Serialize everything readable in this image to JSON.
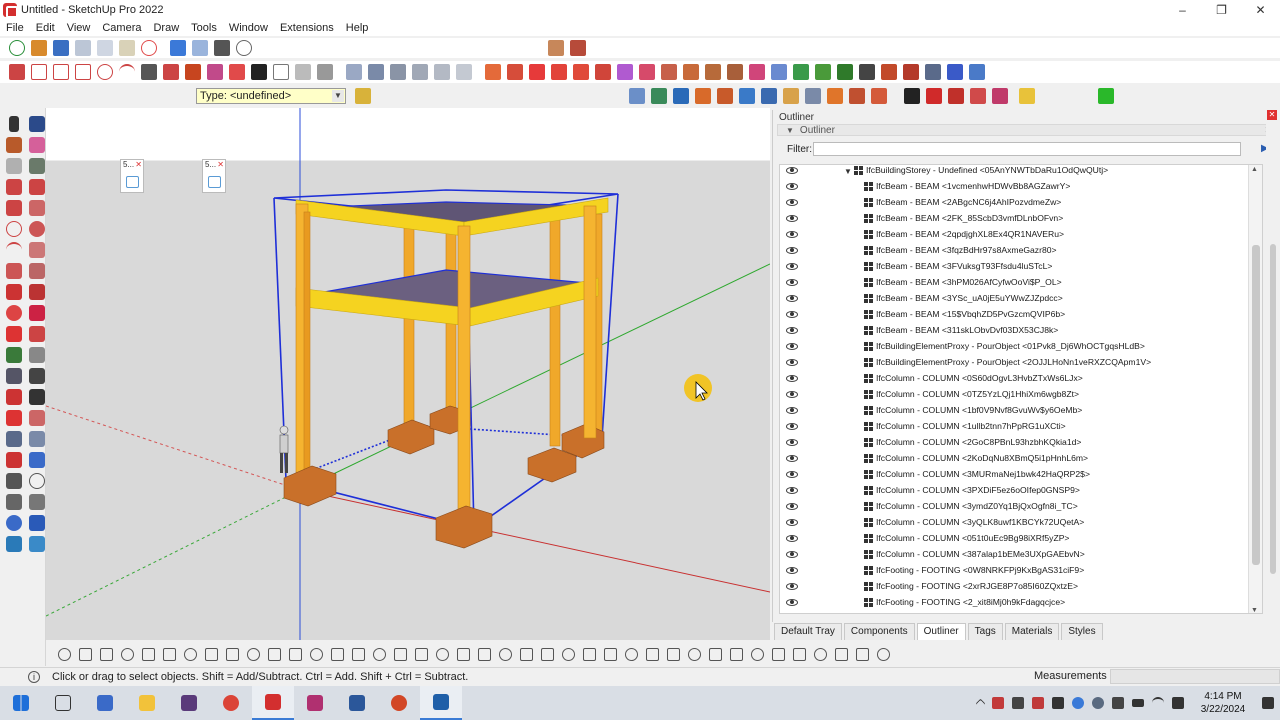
{
  "window": {
    "title": "Untitled - SketchUp Pro 2022",
    "controls": [
      "–",
      "❐",
      "✕"
    ]
  },
  "menu": [
    "File",
    "Edit",
    "View",
    "Camera",
    "Draw",
    "Tools",
    "Window",
    "Extensions",
    "Help"
  ],
  "type_box": {
    "value": "Type: <undefined>"
  },
  "scene_tags": [
    {
      "label": "5..."
    },
    {
      "label": "5..."
    }
  ],
  "outliner": {
    "panel_title": "Outliner",
    "section_title": "Outliner",
    "filter_label": "Filter:",
    "filter_value": "",
    "rows": [
      {
        "text": "IfcBuildingStorey - Undefined <05AnYNWTbDaRu1OdQwQUtj>",
        "level": 0,
        "expanded": true
      },
      {
        "text": "IfcBeam - BEAM <1vcmenhwHDWvBb8AGZawrY>",
        "level": 1
      },
      {
        "text": "IfcBeam - BEAM <2ABgcNC6j4AhIPozvdmeZw>",
        "level": 1
      },
      {
        "text": "IfcBeam - BEAM <2FK_85ScbD3vmfDLnbOFvn>",
        "level": 1
      },
      {
        "text": "IfcBeam - BEAM <2qpdjghXL8Ex4QR1NAVERu>",
        "level": 1
      },
      {
        "text": "IfcBeam - BEAM <3fqzBdHr97s8AxmeGazr80>",
        "level": 1
      },
      {
        "text": "IfcBeam - BEAM <3FVuksgT93Ffsdu4luSTcL>",
        "level": 1
      },
      {
        "text": "IfcBeam - BEAM <3hPM026AfCyfwOoVi$P_OL>",
        "level": 1
      },
      {
        "text": "IfcBeam - BEAM <3YSc_uA0jE5uYWwZJZpdcc>",
        "level": 1
      },
      {
        "text": "IfcBeam - BEAM <15$VbqhZD5PvGzcmQVIP6b>",
        "level": 1
      },
      {
        "text": "IfcBeam - BEAM <311skLObvDvf03DX53CJ8k>",
        "level": 1
      },
      {
        "text": "IfcBuildingElementProxy - PourObject <01Pvk8_Dj6WhOCTgqsHLdB>",
        "level": 1
      },
      {
        "text": "IfcBuildingElementProxy - PourObject <2OJJLHoNn1veRXZCQApm1V>",
        "level": 1
      },
      {
        "text": "IfcColumn - COLUMN <0S60dOgvL3HvbZTxWs6LJx>",
        "level": 1
      },
      {
        "text": "IfcColumn - COLUMN <0TZ5YzLQj1HhiXm6wgb8Zt>",
        "level": 1
      },
      {
        "text": "IfcColumn - COLUMN <1bf0V9Nvf8GvuWv$y6OeMb>",
        "level": 1
      },
      {
        "text": "IfcColumn - COLUMN <1ullb2tnn7hPpRG1uXCti>",
        "level": 1
      },
      {
        "text": "IfcColumn - COLUMN <2GoC8PBnL93hzbhKQkia1d>",
        "level": 1
      },
      {
        "text": "IfcColumn - COLUMN <2KoDqNu8XBmQ5i1pHnhL6m>",
        "level": 1
      },
      {
        "text": "IfcColumn - COLUMN <3MURmaNej1bwk42HaQRP2$>",
        "level": 1
      },
      {
        "text": "IfcColumn - COLUMN <3PXDiF5ez6oOIfep0GNSP9>",
        "level": 1
      },
      {
        "text": "IfcColumn - COLUMN <3ymdZ0Yq1BjQxOgfn8i_TC>",
        "level": 1
      },
      {
        "text": "IfcColumn - COLUMN <3yQLK8uwf1KBCYk72UQetA>",
        "level": 1
      },
      {
        "text": "IfcColumn - COLUMN <051t0uEc9Bg98iXRf5yZP>",
        "level": 1
      },
      {
        "text": "IfcColumn - COLUMN <387alap1bEMe3UXpGAEbvN>",
        "level": 1
      },
      {
        "text": "IfcFooting - FOOTING <0W8NRKFPj9KxBgAS31ciF9>",
        "level": 1
      },
      {
        "text": "IfcFooting - FOOTING <2xrRJGE8P7o85I60ZQxtzE>",
        "level": 1
      },
      {
        "text": "IfcFooting - FOOTING <2_xit8iMj0h9kFdagqcjce>",
        "level": 1
      }
    ]
  },
  "tray_tabs": [
    {
      "label": "Default Tray",
      "active": false
    },
    {
      "label": "Components",
      "active": false
    },
    {
      "label": "Outliner",
      "active": true
    },
    {
      "label": "Tags",
      "active": false
    },
    {
      "label": "Materials",
      "active": false
    },
    {
      "label": "Styles",
      "active": false
    }
  ],
  "status": {
    "message": "Click or drag to select objects. Shift = Add/Subtract. Ctrl = Add. Shift + Ctrl = Subtract.",
    "measurements_label": "Measurements",
    "measurements_value": ""
  },
  "taskbar": {
    "time": "4:14 PM",
    "date": "3/22/2024"
  },
  "colors": {
    "beam_yellow": "#f5d320",
    "column_orange": "#f0a82a",
    "footing_brown": "#c9702a",
    "slab_purple": "#6b6080",
    "selection_blue": "#1e2fd8",
    "cursor_highlight": "#f3c112"
  }
}
